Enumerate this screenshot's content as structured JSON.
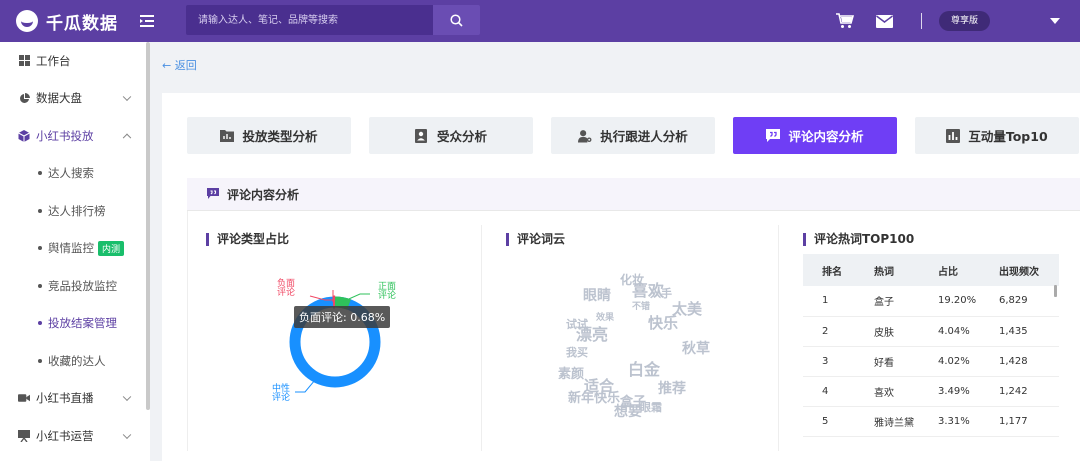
{
  "brand": {
    "name": "千瓜数据"
  },
  "search": {
    "placeholder": "请输入达人、笔记、品牌等搜索"
  },
  "header": {
    "vip_label": "尊享版"
  },
  "sidebar": {
    "items": [
      {
        "label": "工作台"
      },
      {
        "label": "数据大盘"
      },
      {
        "label": "小红书投放"
      },
      {
        "label": "小红书直播"
      },
      {
        "label": "小红书运营"
      }
    ],
    "sub_items": [
      {
        "label": "达人搜索"
      },
      {
        "label": "达人排行榜"
      },
      {
        "label": "舆情监控",
        "tag": "内测"
      },
      {
        "label": "竞品投放监控"
      },
      {
        "label": "投放结案管理"
      },
      {
        "label": "收藏的达人"
      }
    ]
  },
  "main": {
    "back_label": "返回",
    "tabs": [
      {
        "label": "投放类型分析"
      },
      {
        "label": "受众分析"
      },
      {
        "label": "执行跟进人分析"
      },
      {
        "label": "评论内容分析"
      },
      {
        "label": "互动量Top10"
      }
    ],
    "section_title": "评论内容分析"
  },
  "comment_type": {
    "title": "评论类型占比",
    "labels": {
      "negative": "负面评论",
      "positive": "正面评论",
      "neutral": "中性评论"
    },
    "tooltip": "负面评论: 0.68%",
    "colors": {
      "negative": "#f04864",
      "positive": "#2fc25b",
      "neutral": "#1890ff"
    }
  },
  "word_cloud": {
    "title": "评论词云",
    "words": [
      "化妆",
      "喜欢",
      "眼睛",
      "入手",
      "太美",
      "快乐",
      "试试",
      "漂亮",
      "秋草",
      "我买",
      "白金",
      "素颜",
      "适合",
      "推荐",
      "新年快乐",
      "盒子",
      "想要",
      "眼霜",
      "不错",
      "效果"
    ]
  },
  "hot_words": {
    "title": "评论热词TOP100",
    "columns": [
      "排名",
      "热词",
      "占比",
      "出现频次"
    ],
    "rows": [
      {
        "rank": "1",
        "word": "盒子",
        "ratio": "19.20%",
        "count": "6,829"
      },
      {
        "rank": "2",
        "word": "皮肤",
        "ratio": "4.04%",
        "count": "1,435"
      },
      {
        "rank": "3",
        "word": "好看",
        "ratio": "4.02%",
        "count": "1,428"
      },
      {
        "rank": "4",
        "word": "喜欢",
        "ratio": "3.49%",
        "count": "1,242"
      },
      {
        "rank": "5",
        "word": "雅诗兰黛",
        "ratio": "3.31%",
        "count": "1,177"
      }
    ]
  }
}
